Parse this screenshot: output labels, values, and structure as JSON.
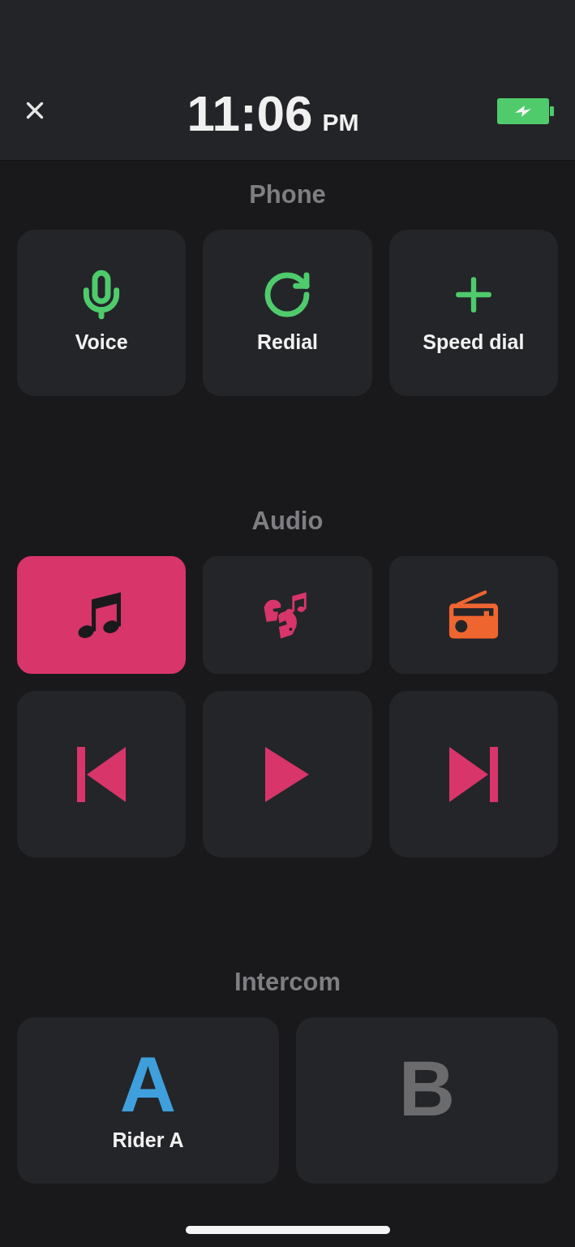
{
  "header": {
    "time": "11:06",
    "meridiem": "PM"
  },
  "phone": {
    "title": "Phone",
    "buttons": [
      {
        "kind": "mic",
        "label": "Voice"
      },
      {
        "kind": "redial",
        "label": "Redial"
      },
      {
        "kind": "plus",
        "label": "Speed dial"
      }
    ]
  },
  "audio": {
    "title": "Audio",
    "sources": [
      {
        "kind": "music",
        "selected": true
      },
      {
        "kind": "phone-music",
        "selected": false
      },
      {
        "kind": "radio",
        "selected": false
      }
    ],
    "controls": [
      {
        "kind": "previous"
      },
      {
        "kind": "play"
      },
      {
        "kind": "next"
      }
    ]
  },
  "intercom": {
    "title": "Intercom",
    "riders": [
      {
        "letter": "A",
        "label": "Rider A",
        "connected": true
      },
      {
        "letter": "B",
        "connected": false
      }
    ]
  }
}
